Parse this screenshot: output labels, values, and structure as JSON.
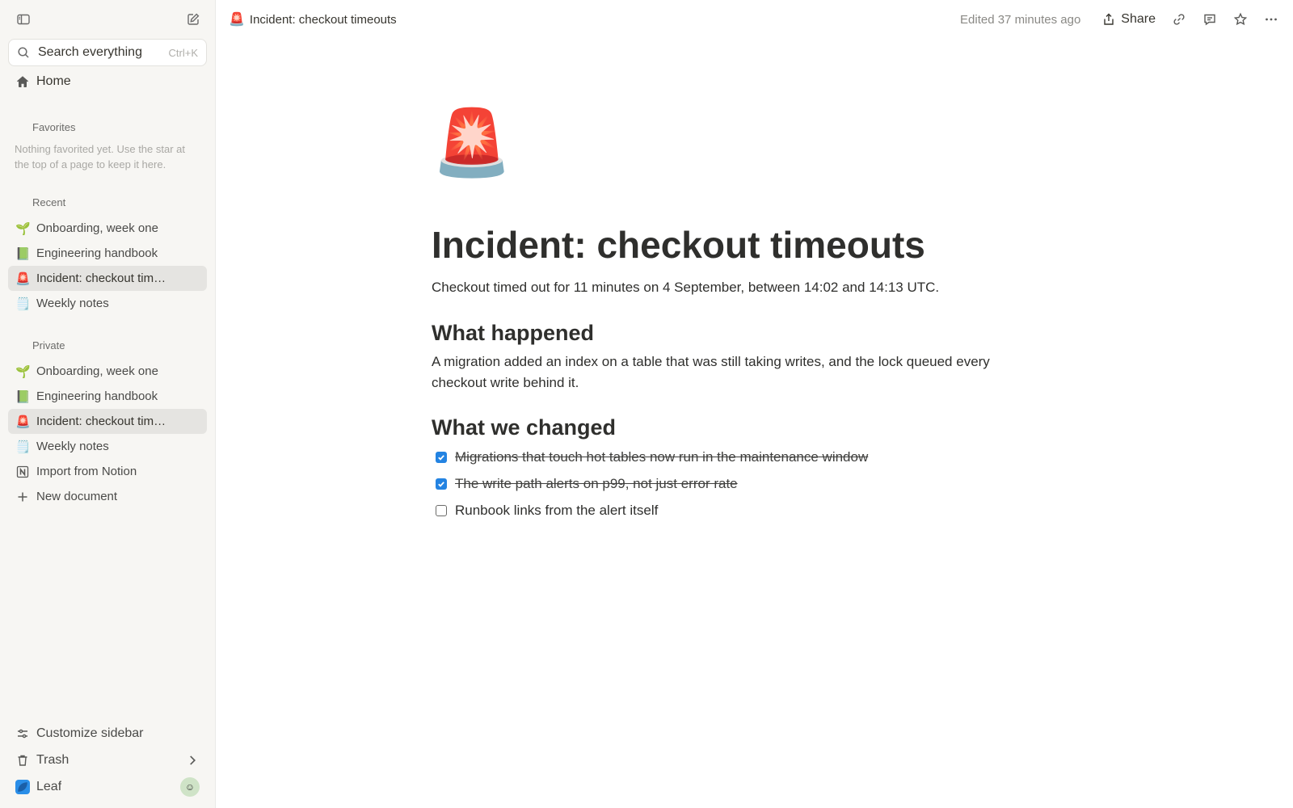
{
  "sidebar": {
    "search": {
      "label": "Search everything",
      "shortcut": "Ctrl+K"
    },
    "home": {
      "label": "Home"
    },
    "favorites": {
      "title": "Favorites",
      "empty_hint": "Nothing favorited yet. Use the star at the top of a page to keep it here."
    },
    "recent": {
      "title": "Recent",
      "items": [
        {
          "emoji": "🌱",
          "label": "Onboarding, week one"
        },
        {
          "emoji": "📗",
          "label": "Engineering handbook"
        },
        {
          "emoji": "🚨",
          "label": "Incident: checkout tim…",
          "active": true
        },
        {
          "emoji": "🗒️",
          "label": "Weekly notes"
        }
      ]
    },
    "private": {
      "title": "Private",
      "items": [
        {
          "emoji": "🌱",
          "label": "Onboarding, week one"
        },
        {
          "emoji": "📗",
          "label": "Engineering handbook"
        },
        {
          "emoji": "🚨",
          "label": "Incident: checkout tim…",
          "active": true
        },
        {
          "emoji": "🗒️",
          "label": "Weekly notes"
        }
      ],
      "import_label": "Import from Notion",
      "new_doc_label": "New document"
    },
    "footer": {
      "customize_label": "Customize sidebar",
      "trash_label": "Trash",
      "workspace_label": "Leaf",
      "accent_color": "#2a8ee8"
    }
  },
  "topbar": {
    "breadcrumb_emoji": "🚨",
    "breadcrumb_title": "Incident: checkout timeouts",
    "edited_text": "Edited 37 minutes ago",
    "share_label": "Share"
  },
  "document": {
    "icon": "🚨",
    "title": "Incident: checkout timeouts",
    "lead": "Checkout timed out for 11 minutes on 4 September, between 14:02 and 14:13 UTC.",
    "section1": {
      "heading": "What happened",
      "body": "A migration added an index on a table that was still taking writes, and the lock queued every checkout write behind it."
    },
    "section2": {
      "heading": "What we changed",
      "todos": [
        {
          "text": "Migrations that touch hot tables now run in the maintenance window",
          "checked": true
        },
        {
          "text": "The write path alerts on p99, not just error rate",
          "checked": true
        },
        {
          "text": "Runbook links from the alert itself",
          "checked": false
        }
      ]
    }
  },
  "colors": {
    "checkbox_checked": "#2383e2",
    "active_item_bg": "#e5e4e1",
    "sidebar_bg": "#f7f6f3"
  }
}
